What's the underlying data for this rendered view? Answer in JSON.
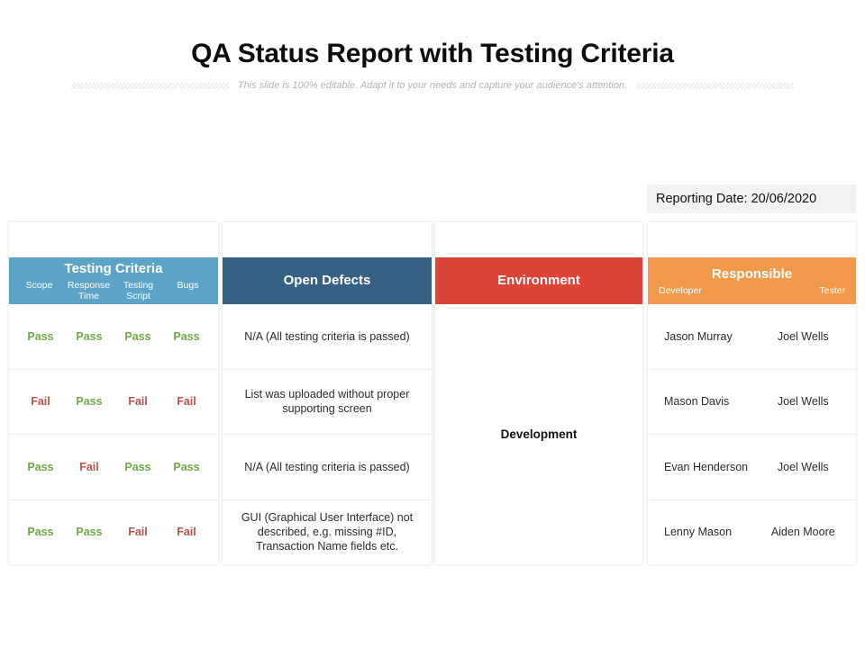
{
  "slide": {
    "title": "QA Status Report with Testing Criteria",
    "subtitle": "This slide is 100% editable. Adapt it to your needs and capture your audience's attention."
  },
  "report_date": {
    "label": "Reporting Date: 20/06/2020"
  },
  "colors": {
    "testing_criteria_header": "#5ba4c8",
    "open_defects_header": "#366184",
    "environment_header": "#dc4437",
    "responsible_header": "#f29a49",
    "pass": "#6faa46",
    "fail": "#c0504d",
    "date_banner_bg": "#f2f2f2"
  },
  "columns": {
    "testing_criteria": {
      "title": "Testing Criteria",
      "subheaders": [
        "Scope",
        "Response Time",
        "Testing Script",
        "Bugs"
      ],
      "rows": [
        [
          "Pass",
          "Pass",
          "Pass",
          "Pass"
        ],
        [
          "Fail",
          "Pass",
          "Fail",
          "Fail"
        ],
        [
          "Pass",
          "Fail",
          "Pass",
          "Pass"
        ],
        [
          "Pass",
          "Pass",
          "Fail",
          "Fail"
        ]
      ]
    },
    "open_defects": {
      "title": "Open Defects",
      "rows": [
        "N/A (All testing criteria is passed)",
        "List was uploaded without proper supporting screen",
        "N/A (All testing criteria is passed)",
        "GUI (Graphical User Interface) not described, e.g. missing #ID, Transaction Name fields etc."
      ]
    },
    "environment": {
      "title": "Environment",
      "value": "Development"
    },
    "responsible": {
      "title": "Responsible",
      "subheaders": [
        "Developer",
        "Tester"
      ],
      "rows": [
        {
          "developer": "Jason Murray",
          "tester": "Joel Wells"
        },
        {
          "developer": "Mason Davis",
          "tester": "Joel Wells"
        },
        {
          "developer": "Evan Henderson",
          "tester": "Joel Wells"
        },
        {
          "developer": "Lenny Mason",
          "tester": "Aiden Moore"
        }
      ]
    }
  }
}
